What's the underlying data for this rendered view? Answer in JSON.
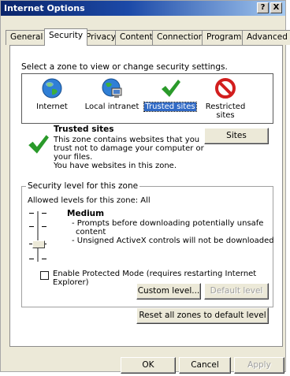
{
  "window": {
    "title": "Internet Options",
    "help_btn": "?",
    "close_btn": "X"
  },
  "tabs": [
    {
      "label": "General"
    },
    {
      "label": "Security"
    },
    {
      "label": "Privacy"
    },
    {
      "label": "Content"
    },
    {
      "label": "Connections"
    },
    {
      "label": "Programs"
    },
    {
      "label": "Advanced"
    }
  ],
  "security": {
    "instruction": "Select a zone to view or change security settings.",
    "zones": [
      {
        "label": "Internet",
        "icon": "globe-icon"
      },
      {
        "label": "Local intranet",
        "icon": "intranet-icon"
      },
      {
        "label": "Trusted sites",
        "icon": "checkmark-icon",
        "selected": true
      },
      {
        "label": "Restricted sites",
        "icon": "no-entry-icon"
      }
    ],
    "zone_title": "Trusted sites",
    "zone_desc_1": "This zone contains websites that you",
    "zone_desc_2": "trust not to damage your computer or",
    "zone_desc_3": "your files.",
    "zone_desc_4": "You have websites in this zone.",
    "sites_button": "Sites"
  },
  "level": {
    "group_label": "Security level for this zone",
    "allowed": "Allowed levels for this zone: All",
    "level_name": "Medium",
    "bullet_1a": "- Prompts before downloading potentially unsafe",
    "bullet_1b": "content",
    "bullet_2": "- Unsigned ActiveX controls will not be downloaded",
    "protected_mode": "Enable Protected Mode (requires restarting Internet Explorer)",
    "protected_mode_checked": false,
    "custom_level": "Custom level...",
    "default_level": "Default level",
    "reset_all": "Reset all zones to default level"
  },
  "footer": {
    "ok": "OK",
    "cancel": "Cancel",
    "apply": "Apply"
  },
  "colors": {
    "accent_selected": "#316ac5",
    "trusted_green": "#2a9a2a",
    "restricted_red": "#d21e1e"
  }
}
